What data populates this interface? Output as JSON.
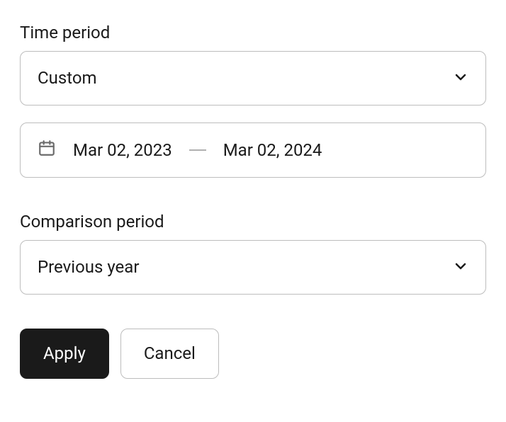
{
  "timePeriod": {
    "label": "Time period",
    "selected": "Custom",
    "dateRange": {
      "start": "Mar 02, 2023",
      "end": "Mar 02, 2024"
    }
  },
  "comparisonPeriod": {
    "label": "Comparison period",
    "selected": "Previous year"
  },
  "buttons": {
    "apply": "Apply",
    "cancel": "Cancel"
  }
}
